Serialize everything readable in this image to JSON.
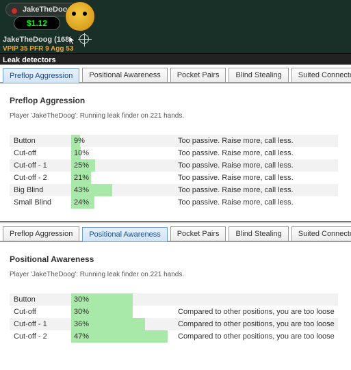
{
  "hud": {
    "player_name": "JakeTheDoog",
    "stack": "$1.12",
    "name_with_hands": "JakeTheDoog (168)",
    "stats_line": "VPIP 35  PFR 9  Agg 53"
  },
  "leak_header": "Leak detectors",
  "tabs": [
    {
      "label": "Preflop Aggression"
    },
    {
      "label": "Positional Awareness"
    },
    {
      "label": "Pocket Pairs"
    },
    {
      "label": "Blind Stealing"
    },
    {
      "label": "Suited Connectors"
    }
  ],
  "section1": {
    "active_tab": 0,
    "heading": "Preflop Aggression",
    "subtitle": "Player 'JakeTheDoog': Running leak finder on 221 hands.",
    "rows": [
      {
        "pos": "Button",
        "pct": 9,
        "note": "Too passive. Raise more, call less."
      },
      {
        "pos": "Cut-off",
        "pct": 10,
        "note": "Too passive. Raise more, call less."
      },
      {
        "pos": "Cut-off - 1",
        "pct": 25,
        "note": "Too passive. Raise more, call less."
      },
      {
        "pos": "Cut-off - 2",
        "pct": 21,
        "note": "Too passive. Raise more, call less."
      },
      {
        "pos": "Big Blind",
        "pct": 43,
        "note": "Too passive. Raise more, call less."
      },
      {
        "pos": "Small Blind",
        "pct": 24,
        "note": "Too passive. Raise more, call less."
      }
    ]
  },
  "section2": {
    "active_tab": 1,
    "heading": "Positional Awareness",
    "subtitle": "Player 'JakeTheDoog': Running leak finder on 221 hands.",
    "rows": [
      {
        "pos": "Button",
        "pct": 30,
        "note": ""
      },
      {
        "pos": "Cut-off",
        "pct": 30,
        "note": "Compared to other positions, you are too loose"
      },
      {
        "pos": "Cut-off - 1",
        "pct": 36,
        "note": "Compared to other positions, you are too loose"
      },
      {
        "pos": "Cut-off - 2",
        "pct": 47,
        "note": "Compared to other positions, you are too loose"
      }
    ]
  },
  "chart_data": [
    {
      "type": "bar",
      "title": "Preflop Aggression",
      "categories": [
        "Button",
        "Cut-off",
        "Cut-off - 1",
        "Cut-off - 2",
        "Big Blind",
        "Small Blind"
      ],
      "values": [
        9,
        10,
        25,
        21,
        43,
        24
      ],
      "xlabel": "",
      "ylabel": "%",
      "ylim": [
        0,
        100
      ]
    },
    {
      "type": "bar",
      "title": "Positional Awareness",
      "categories": [
        "Button",
        "Cut-off",
        "Cut-off - 1",
        "Cut-off - 2"
      ],
      "values": [
        30,
        30,
        36,
        47
      ],
      "xlabel": "",
      "ylabel": "%",
      "ylim": [
        0,
        100
      ]
    }
  ]
}
